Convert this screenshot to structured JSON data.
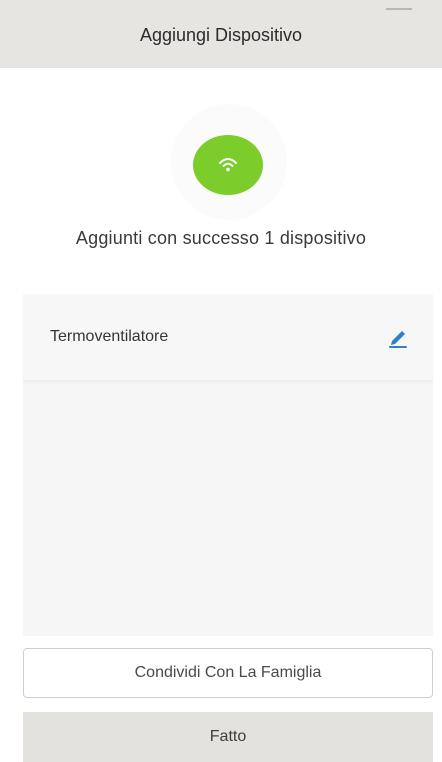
{
  "header": {
    "title": "Aggiungi Dispositivo"
  },
  "status": {
    "icon": "wifi-icon",
    "color": "#7ccd2c",
    "message": "Aggiunti con successo 1 dispositivo"
  },
  "devices": [
    {
      "name": "Termoventilatore",
      "action_icon": "pencil-icon",
      "action_color": "#2f80c8"
    }
  ],
  "actions": {
    "share_label": "Condividi Con La Famiglia",
    "done_label": "Fatto"
  }
}
